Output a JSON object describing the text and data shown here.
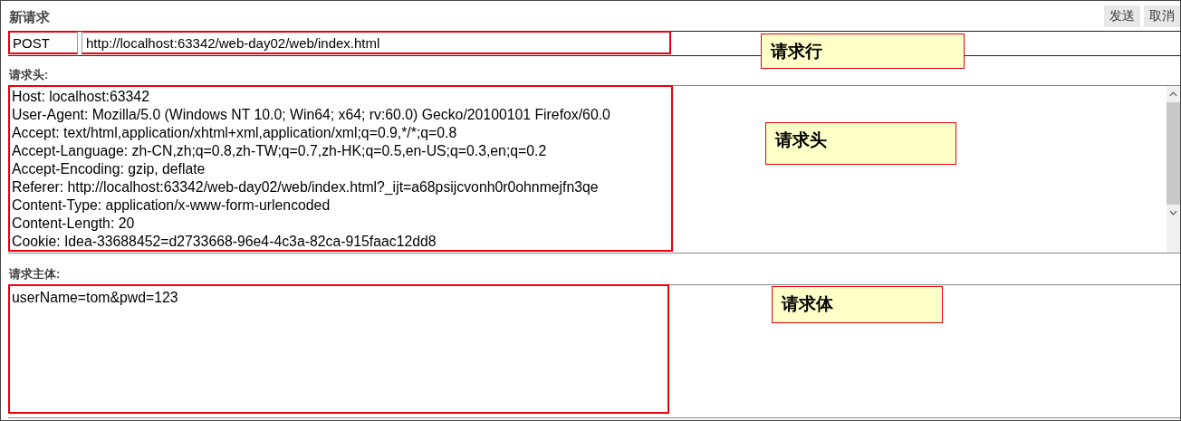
{
  "title": "新请求",
  "buttons": [
    {
      "label": "发送"
    },
    {
      "label": "取消"
    }
  ],
  "request_line": {
    "method": "POST",
    "url": "http://localhost:63342/web-day02/web/index.html"
  },
  "headers_label": "请求头:",
  "headers": [
    "Host: localhost:63342",
    "User-Agent: Mozilla/5.0 (Windows NT 10.0; Win64; x64; rv:60.0) Gecko/20100101 Firefox/60.0",
    "Accept: text/html,application/xhtml+xml,application/xml;q=0.9,*/*;q=0.8",
    "Accept-Language: zh-CN,zh;q=0.8,zh-TW;q=0.7,zh-HK;q=0.5,en-US;q=0.3,en;q=0.2",
    "Accept-Encoding: gzip, deflate",
    "Referer: http://localhost:63342/web-day02/web/index.html?_ijt=a68psijcvonh0r0ohnmejfn3qe",
    "Content-Type: application/x-www-form-urlencoded",
    "Content-Length: 20",
    "Cookie: Idea-33688452=d2733668-96e4-4c3a-82ca-915faac12dd8"
  ],
  "body_label": "请求主体:",
  "body": "userName=tom&pwd=123",
  "annotations": [
    {
      "text": "请求行"
    },
    {
      "text": "请求头"
    },
    {
      "text": "请求体"
    }
  ]
}
